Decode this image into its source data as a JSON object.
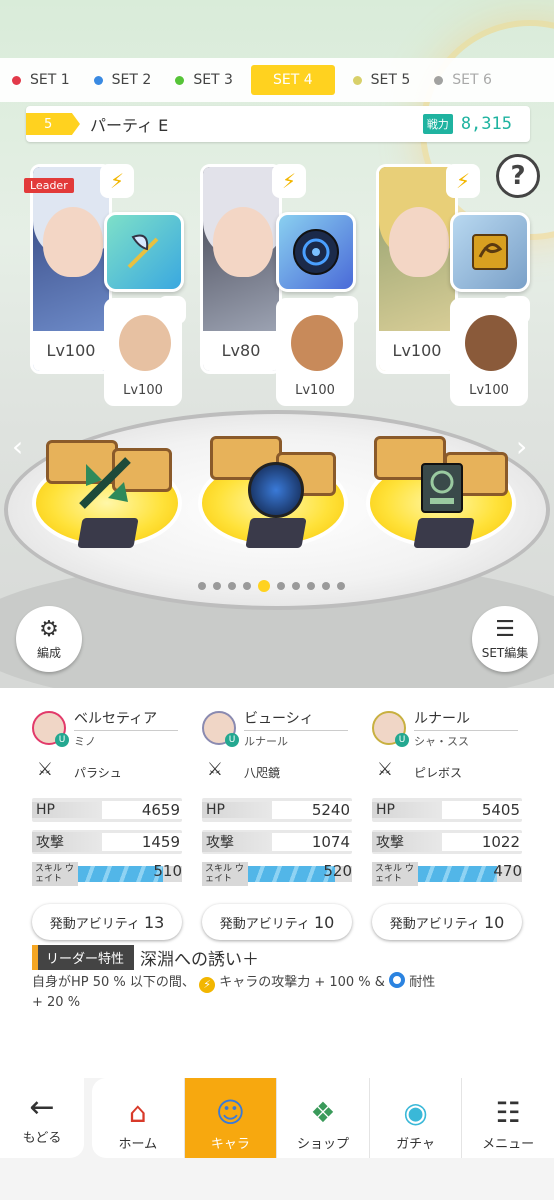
{
  "tabs": [
    {
      "label": "SET 1",
      "dot": "#e23a4a"
    },
    {
      "label": "SET 2",
      "dot": "#3a8ae2"
    },
    {
      "label": "SET 3",
      "dot": "#56c438"
    },
    {
      "label": "SET 4",
      "active": true
    },
    {
      "label": "SET 5",
      "dot": "#d8d06a"
    },
    {
      "label": "SET 6",
      "dot": "#333333"
    }
  ],
  "party": {
    "number": "5",
    "name": "パーティ E",
    "power_label": "戦力",
    "power": "8,315"
  },
  "help_label": "?",
  "leader_label": "Leader",
  "characters": [
    {
      "main_lv": "Lv100",
      "sub_lv": "Lv100"
    },
    {
      "main_lv": "Lv80",
      "sub_lv": "Lv100"
    },
    {
      "main_lv": "Lv100",
      "sub_lv": "Lv100"
    }
  ],
  "page_dots": {
    "count": 10,
    "active": 4
  },
  "buttons": {
    "formation": "編成",
    "set_edit": "SET編集"
  },
  "stats": [
    {
      "name": "ベルセティア",
      "sub": "ミノ",
      "weapon": "パラシュ",
      "hp_label": "HP",
      "hp": "4659",
      "atk_label": "攻撃",
      "atk": "1459",
      "wait_label": "スキル ウェイト",
      "wait": "510",
      "wait_fill": 0.82,
      "ability_label": "発動アビリティ",
      "ability": "13"
    },
    {
      "name": "ビューシィ",
      "sub": "ルナール",
      "weapon": "八咫鏡",
      "hp_label": "HP",
      "hp": "5240",
      "atk_label": "攻撃",
      "atk": "1074",
      "wait_label": "スキル ウェイト",
      "wait": "520",
      "wait_fill": 0.84,
      "ability_label": "発動アビリティ",
      "ability": "10"
    },
    {
      "name": "ルナール",
      "sub": "シャ・スス",
      "weapon": "ピレボス",
      "hp_label": "HP",
      "hp": "5405",
      "atk_label": "攻撃",
      "atk": "1022",
      "wait_label": "スキル ウェイト",
      "wait": "470",
      "wait_fill": 0.76,
      "ability_label": "発動アビリティ",
      "ability": "10"
    }
  ],
  "leader_trait": {
    "tag": "リーダー特性",
    "name": "深淵への誘い＋",
    "desc_1": "自身がHP 50 % 以下の間、",
    "desc_2": "キャラの攻撃力 + 100 % &",
    "desc_3": "耐性",
    "desc_4": "+ 20 %"
  },
  "nav": {
    "back": "もどる",
    "items": [
      {
        "label": "ホーム",
        "icon": "home-icon"
      },
      {
        "label": "キャラ",
        "icon": "character-icon",
        "active": true
      },
      {
        "label": "ショップ",
        "icon": "shop-icon"
      },
      {
        "label": "ガチャ",
        "icon": "gacha-icon"
      },
      {
        "label": "メニュー",
        "icon": "menu-icon"
      }
    ]
  }
}
